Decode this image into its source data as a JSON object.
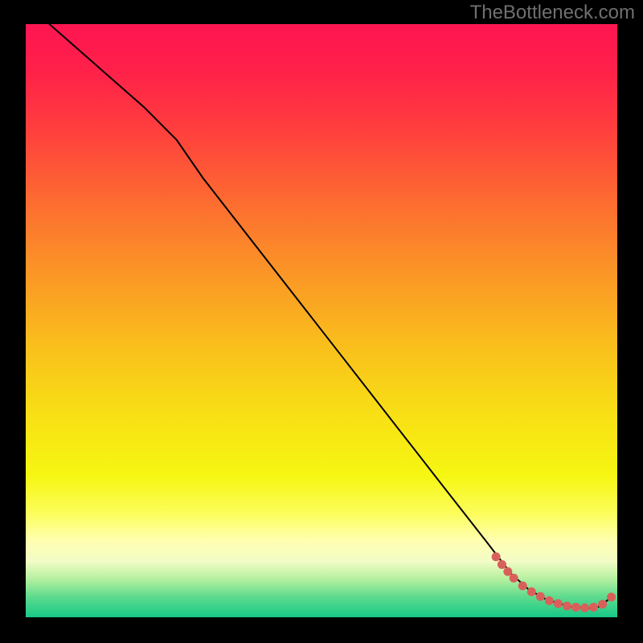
{
  "watermark": "TheBottleneck.com",
  "colors": {
    "black": "#000000",
    "line": "#000000",
    "dot": "#d9605a",
    "gradient_stops": [
      {
        "offset": 0.0,
        "color": "#ff1552"
      },
      {
        "offset": 0.08,
        "color": "#ff2149"
      },
      {
        "offset": 0.18,
        "color": "#ff3f3d"
      },
      {
        "offset": 0.3,
        "color": "#fd6c31"
      },
      {
        "offset": 0.42,
        "color": "#fb9626"
      },
      {
        "offset": 0.54,
        "color": "#f9be1c"
      },
      {
        "offset": 0.66,
        "color": "#f8e015"
      },
      {
        "offset": 0.76,
        "color": "#f6f611"
      },
      {
        "offset": 0.825,
        "color": "#fcfd5b"
      },
      {
        "offset": 0.87,
        "color": "#ffffb0"
      },
      {
        "offset": 0.905,
        "color": "#f3fcc6"
      },
      {
        "offset": 0.935,
        "color": "#b7f0a0"
      },
      {
        "offset": 0.965,
        "color": "#5fdb8e"
      },
      {
        "offset": 1.0,
        "color": "#17c987"
      }
    ]
  },
  "chart_data": {
    "type": "line",
    "title": "",
    "xlabel": "",
    "ylabel": "",
    "xlim": [
      0,
      100
    ],
    "ylim": [
      0,
      100
    ],
    "series": [
      {
        "name": "curve",
        "style": "line",
        "color_key": "line",
        "width": 2,
        "x": [
          4,
          12,
          20,
          25.5,
          30,
          40,
          50,
          60,
          70,
          78,
          82,
          85,
          88,
          92,
          95,
          97,
          99
        ],
        "y": [
          100,
          93,
          86,
          80.5,
          74,
          61.2,
          48.4,
          35.6,
          22.8,
          12.6,
          7.4,
          4.7,
          3.0,
          1.8,
          1.5,
          1.8,
          3.4
        ]
      },
      {
        "name": "bottleneck-region",
        "style": "dots",
        "color_key": "dot",
        "radius": 5.5,
        "x": [
          79.5,
          80.5,
          81.5,
          82.5,
          84,
          85.5,
          87,
          88.5,
          90,
          91.5,
          93,
          94.5,
          96,
          97.5,
          99
        ],
        "y": [
          10.2,
          8.9,
          7.7,
          6.6,
          5.3,
          4.3,
          3.5,
          2.8,
          2.3,
          1.9,
          1.7,
          1.6,
          1.7,
          2.2,
          3.4
        ]
      }
    ]
  }
}
